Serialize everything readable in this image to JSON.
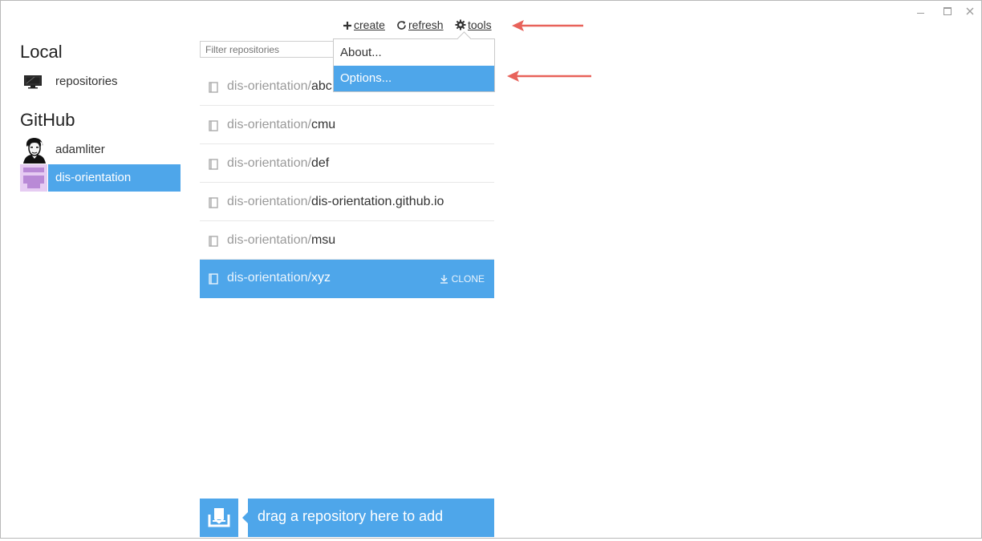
{
  "window": {
    "controls": [
      "minimize",
      "maximize",
      "close"
    ]
  },
  "sidebar": {
    "local_title": "Local",
    "local_items": [
      {
        "label": "repositories",
        "icon": "monitor-icon"
      }
    ],
    "github_title": "GitHub",
    "github_items": [
      {
        "label": "adamliter",
        "icon": "user-avatar"
      },
      {
        "label": "dis-orientation",
        "icon": "org-avatar",
        "selected": true
      }
    ]
  },
  "toolbar": {
    "create": "create",
    "refresh": "refresh",
    "tools": "tools"
  },
  "filter": {
    "placeholder": "Filter repositories"
  },
  "tools_menu": {
    "items": [
      "About...",
      "Options..."
    ],
    "highlighted": "Options..."
  },
  "repositories": {
    "owner": "dis-orientation/",
    "items": [
      {
        "name": "abc"
      },
      {
        "name": "cmu"
      },
      {
        "name": "def"
      },
      {
        "name": "dis-orientation.github.io"
      },
      {
        "name": "msu"
      },
      {
        "name": "xyz",
        "selected": true,
        "action": "CLONE"
      }
    ]
  },
  "dropzone": {
    "text": "drag a repository here to add"
  },
  "colors": {
    "accent": "#4ea6ea",
    "annotation_arrow": "#e8625a",
    "org_avatar": "#b98ad6"
  }
}
